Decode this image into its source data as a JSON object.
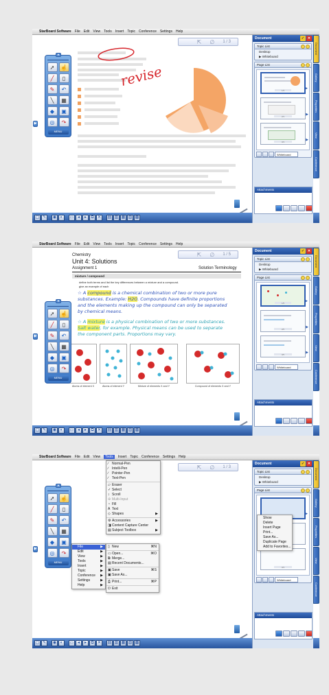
{
  "app": {
    "brand": "StarBoard Software",
    "menus": [
      "File",
      "Edit",
      "View",
      "Tools",
      "Insert",
      "Topic",
      "Conference",
      "Settings",
      "Help"
    ]
  },
  "pagebar": {
    "counter1": "1 / 3",
    "counter2": "1 / 5",
    "counter3": "1 / 3"
  },
  "palette": {
    "menu_label": "MENU"
  },
  "right_panel": {
    "title": "Document",
    "topic_list_label": "Topic List",
    "topics": [
      "Desktop",
      "Whiteboard"
    ],
    "page_list_label": "Page List",
    "view_select": "Whiteboard",
    "attachments_label": "Attachments",
    "tabs": [
      "Document",
      "Gallery",
      "Properties",
      "View",
      "Conference"
    ]
  },
  "frame1": {
    "annotation": "revise",
    "pie_colors": [
      "#f4a566",
      "#f8c29a",
      "#fbd9bf"
    ]
  },
  "frame2": {
    "subject": "Chemistry",
    "unit": "Unit 4: Solutions",
    "assignment": "Assignment 1",
    "section": "Solution Terminology",
    "label_box": "mixture / compound",
    "instructions1": "define both terms and list the key differences between a mixture and a compound.",
    "instructions2": "give an example of each",
    "compound_lines": [
      "A compound is a chemical combination of two or more pure",
      "substances. Example: H2O. Compounds have definite proportions",
      "and the elements making up the compound can only be separated",
      "by chemical means."
    ],
    "mixture_lines": [
      "A mixture is a physical combination of two or more substances.",
      "Salt water, for example. Physical means can be used to separate",
      "the component parts. Proportions may vary."
    ],
    "captions": [
      "Atoms of element X",
      "Atoms of element Y",
      "Mixture of elements X and Y",
      "Compound of elements X and Y"
    ]
  },
  "frame3": {
    "tools_menu": [
      {
        "label": "Normal-Pen",
        "icon": "pen"
      },
      {
        "label": "Intelli-Pen",
        "icon": "pen"
      },
      {
        "label": "Pointer-Pen",
        "icon": "pen"
      },
      {
        "label": "Text-Pen",
        "icon": "pen"
      },
      {
        "label": "Eraser",
        "icon": "eraser"
      },
      {
        "label": "Select",
        "icon": "select",
        "checked": "✓"
      },
      {
        "label": "Scroll",
        "icon": "scroll"
      },
      {
        "label": "Multi-Input",
        "icon": "multi",
        "dim": true
      },
      {
        "label": "Fill",
        "icon": "fill"
      },
      {
        "label": "Text",
        "icon": "text"
      },
      {
        "label": "Shapes",
        "icon": "shapes",
        "submenu": true
      },
      {
        "label": "Accessories",
        "icon": "gear",
        "submenu": true
      },
      {
        "label": "Content Capture Center",
        "icon": "capture"
      },
      {
        "label": "Subject Toolbox",
        "icon": "toolbox",
        "submenu": true
      }
    ],
    "menu_list": [
      "File",
      "Edit",
      "View",
      "Tools",
      "Insert",
      "Topic",
      "Conference",
      "Settings",
      "Help"
    ],
    "file_menu": [
      {
        "label": "New",
        "shortcut": "⌘N"
      },
      {
        "label": "Open...",
        "shortcut": "⌘O"
      },
      {
        "label": "Merge...",
        "shortcut": ""
      },
      {
        "label": "Recent Documents...",
        "shortcut": ""
      },
      {
        "label": "Save",
        "shortcut": "⌘S"
      },
      {
        "label": "Save As...",
        "shortcut": ""
      },
      {
        "label": "Print...",
        "shortcut": "⌘P"
      },
      {
        "label": "Exit",
        "shortcut": ""
      }
    ],
    "context_menu": [
      "Show",
      "Delete",
      "Insert Page",
      "Print...",
      "Save As...",
      "Duplicate Page",
      "Add to Favorites..."
    ]
  }
}
